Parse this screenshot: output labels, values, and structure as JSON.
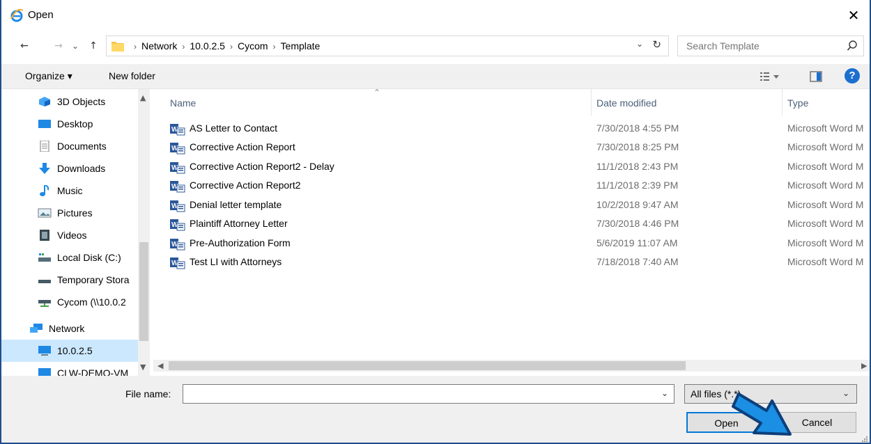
{
  "window": {
    "title": "Open",
    "close_glyph": "✕"
  },
  "nav": {
    "back_glyph": "←",
    "forward_glyph": "→",
    "recent_glyph": "⌄",
    "up_glyph": "↑",
    "breadcrumb": [
      "Network",
      "10.0.2.5",
      "Cycom",
      "Template"
    ],
    "breadcrumb_sep": "›",
    "refresh_glyph": "↻",
    "dropdown_glyph": "⌄"
  },
  "search": {
    "placeholder": "Search Template"
  },
  "toolbar": {
    "organize_label": "Organize ▾",
    "new_folder_label": "New folder",
    "help_label": "?"
  },
  "sidebar": {
    "items": [
      {
        "label": "3D Objects",
        "icon": "3d-objects-icon"
      },
      {
        "label": "Desktop",
        "icon": "desktop-icon"
      },
      {
        "label": "Documents",
        "icon": "documents-icon"
      },
      {
        "label": "Downloads",
        "icon": "downloads-icon"
      },
      {
        "label": "Music",
        "icon": "music-icon"
      },
      {
        "label": "Pictures",
        "icon": "pictures-icon"
      },
      {
        "label": "Videos",
        "icon": "videos-icon"
      },
      {
        "label": "Local Disk (C:)",
        "icon": "local-disk-icon"
      },
      {
        "label": "Temporary Stora",
        "icon": "drive-icon"
      },
      {
        "label": "Cycom (\\\\10.0.2",
        "icon": "network-drive-icon"
      },
      {
        "label": "Network",
        "icon": "network-icon"
      },
      {
        "label": "10.0.2.5",
        "icon": "computer-icon",
        "selected": true
      },
      {
        "label": "CLW-DEMO-VM",
        "icon": "computer-icon"
      }
    ]
  },
  "columns": {
    "name": "Name",
    "date": "Date modified",
    "type": "Type"
  },
  "files": [
    {
      "name": "AS Letter to Contact",
      "date": "7/30/2018 4:55 PM",
      "type": "Microsoft Word M"
    },
    {
      "name": "Corrective Action Report",
      "date": "7/30/2018 8:25 PM",
      "type": "Microsoft Word M"
    },
    {
      "name": "Corrective Action Report2 - Delay",
      "date": "11/1/2018 2:43 PM",
      "type": "Microsoft Word M"
    },
    {
      "name": "Corrective Action Report2",
      "date": "11/1/2018 2:39 PM",
      "type": "Microsoft Word M"
    },
    {
      "name": "Denial letter template",
      "date": "10/2/2018 9:47 AM",
      "type": "Microsoft Word M"
    },
    {
      "name": "Plaintiff Attorney Letter",
      "date": "7/30/2018 4:46 PM",
      "type": "Microsoft Word M"
    },
    {
      "name": "Pre-Authorization Form",
      "date": "5/6/2019 11:07 AM",
      "type": "Microsoft Word M"
    },
    {
      "name": "Test LI with Attorneys",
      "date": "7/18/2018 7:40 AM",
      "type": "Microsoft Word M"
    }
  ],
  "footer": {
    "file_name_label": "File name:",
    "file_name_value": "",
    "filter_value": "All files (*.*)",
    "open_label": "Open",
    "cancel_label": "Cancel"
  },
  "colors": {
    "accent": "#0078d7",
    "selection": "#cce8ff",
    "annotation_arrow": "#1a8fe3"
  }
}
